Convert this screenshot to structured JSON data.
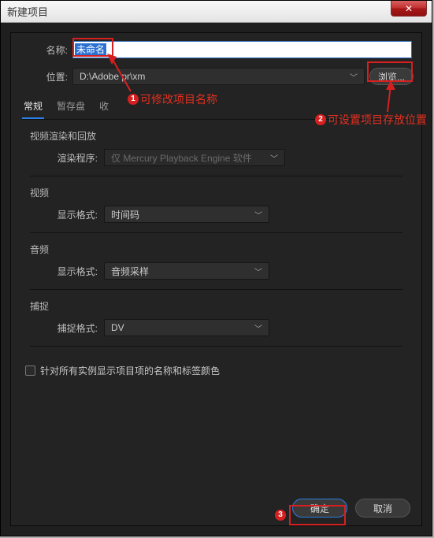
{
  "titlebar": {
    "title": "新建项目"
  },
  "name": {
    "label": "名称:",
    "value": "未命名"
  },
  "location": {
    "label": "位置:",
    "value": "D:\\Adobe pr\\xm",
    "browse_label": "浏览..."
  },
  "tabs": {
    "general": "常规",
    "scratch": "暂存盘",
    "ingest": "收"
  },
  "render": {
    "section": "视频渲染和回放",
    "label": "渲染程序:",
    "value": "仅 Mercury Playback Engine 软件"
  },
  "video": {
    "section": "视频",
    "label": "显示格式:",
    "value": "时间码"
  },
  "audio": {
    "section": "音频",
    "label": "显示格式:",
    "value": "音频采样"
  },
  "capture": {
    "section": "捕捉",
    "label": "捕捉格式:",
    "value": "DV"
  },
  "checkbox": {
    "label": "针对所有实例显示项目项的名称和标签颜色"
  },
  "footer": {
    "ok": "确定",
    "cancel": "取消"
  },
  "annotations": {
    "a1": "可修改项目名称",
    "a2": "可设置项目存放位置",
    "n1": "1",
    "n2": "2",
    "n3": "3"
  }
}
